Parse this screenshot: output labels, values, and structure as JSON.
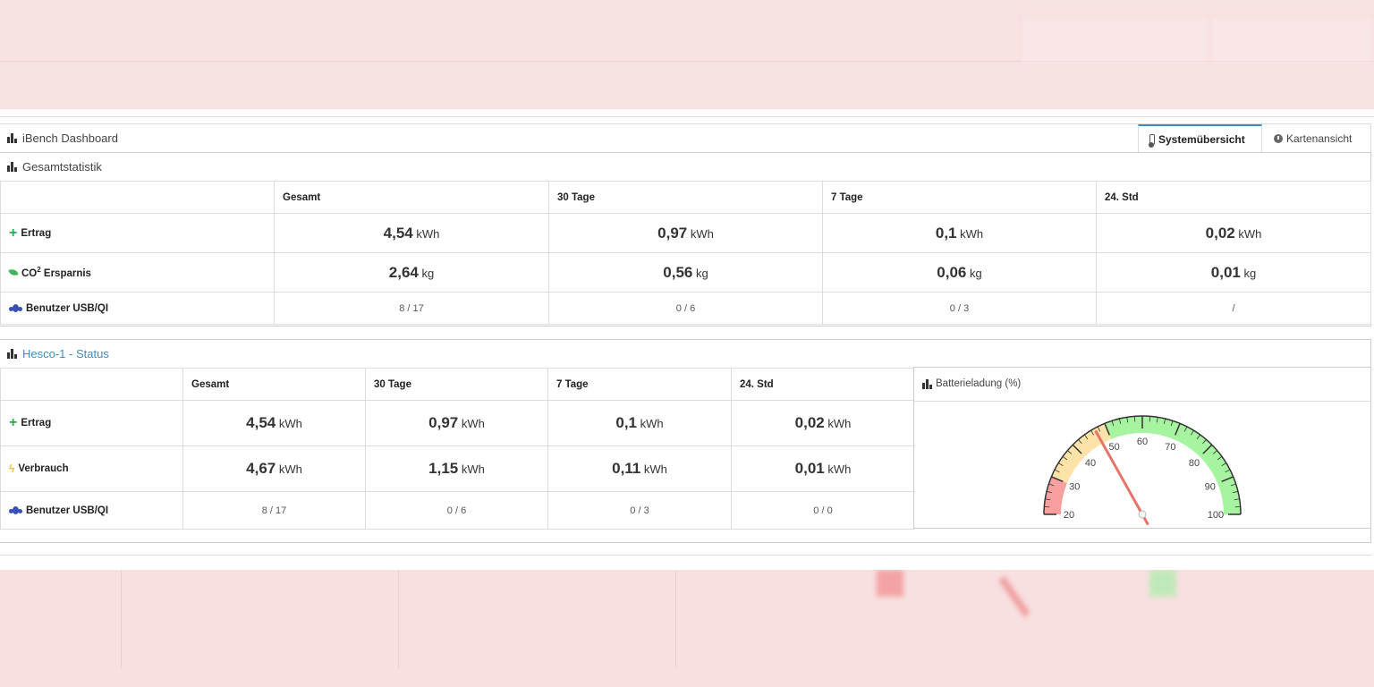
{
  "dashboard": {
    "title": "iBench Dashboard",
    "tabs": [
      {
        "label": "Systemübersicht",
        "active": true
      },
      {
        "label": "Kartenansicht",
        "active": false
      }
    ]
  },
  "gesamt": {
    "title": "Gesamtstatistik",
    "columns": [
      "Gesamt",
      "30 Tage",
      "7 Tage",
      "24. Std"
    ],
    "rows": [
      {
        "label": "Ertrag",
        "icon": "plus-icon",
        "values": [
          "4,54",
          "0,97",
          "0,1",
          "0,02"
        ],
        "unit": "kWh"
      },
      {
        "label_main": "CO",
        "label_sup": "2",
        "label_rest": " Ersparnis",
        "icon": "leaf-icon",
        "values": [
          "2,64",
          "0,56",
          "0,06",
          "0,01"
        ],
        "unit": "kg"
      },
      {
        "label": "Benutzer USB/QI",
        "icon": "users-icon",
        "values": [
          "8 / 17",
          "0 / 6",
          "0 / 3",
          "/"
        ]
      }
    ]
  },
  "hesco": {
    "title": "Hesco-1 - Status",
    "columns": [
      "Gesamt",
      "30 Tage",
      "7 Tage",
      "24. Std"
    ],
    "rows": [
      {
        "label": "Ertrag",
        "icon": "plus-icon",
        "values": [
          "4,54",
          "0,97",
          "0,1",
          "0,02"
        ],
        "unit": "kWh"
      },
      {
        "label": "Verbrauch",
        "icon": "bolt-icon",
        "values": [
          "4,67",
          "1,15",
          "0,11",
          "0,01"
        ],
        "unit": "kWh"
      },
      {
        "label": "Benutzer USB/QI",
        "icon": "users-icon",
        "values": [
          "8 / 17",
          "0 / 6",
          "0 / 3",
          "0 / 0"
        ]
      }
    ]
  },
  "gauge": {
    "title": "Batterieladung (%)",
    "min": 20,
    "max": 100,
    "ticks": [
      "20",
      "30",
      "40",
      "50",
      "60",
      "70",
      "80",
      "90",
      "100"
    ],
    "value": 47,
    "bands": [
      {
        "from": 20,
        "to": 30,
        "color": "#f8a0a0"
      },
      {
        "from": 30,
        "to": 50,
        "color": "#fde3a7"
      },
      {
        "from": 50,
        "to": 100,
        "color": "#a6f3a0"
      }
    ],
    "needle_color": "#e8736a"
  }
}
